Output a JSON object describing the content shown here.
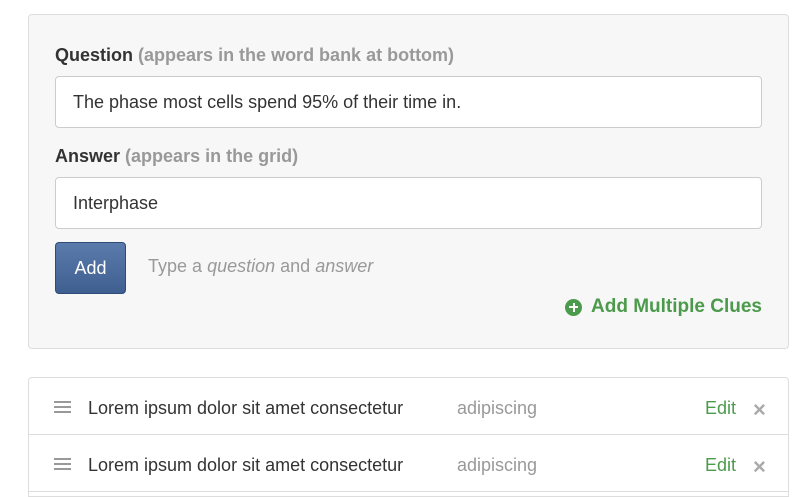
{
  "form": {
    "question_label": "Question",
    "question_hint": "(appears in the word bank at bottom)",
    "question_value": "The phase most cells spend 95% of their time in.",
    "answer_label": "Answer",
    "answer_hint": "(appears in the grid)",
    "answer_value": "Interphase",
    "add_label": "Add",
    "help_prefix": "Type a",
    "help_question": "question",
    "help_and": "and",
    "help_answer": "answer",
    "add_multiple_label": "Add Multiple Clues",
    "add_multiple_icon": "plus-circle-icon"
  },
  "clues": [
    {
      "question": "Lorem ipsum dolor sit amet consectetur",
      "answer": "adipiscing",
      "edit_label": "Edit",
      "remove_glyph": "×"
    },
    {
      "question": "Lorem ipsum dolor sit amet consectetur",
      "answer": "adipiscing",
      "edit_label": "Edit",
      "remove_glyph": "×"
    }
  ],
  "colors": {
    "accent_green": "#4c9a4c",
    "button_blue": "#4a6b9e",
    "muted_text": "#999999",
    "panel_bg": "#f7f7f7"
  }
}
